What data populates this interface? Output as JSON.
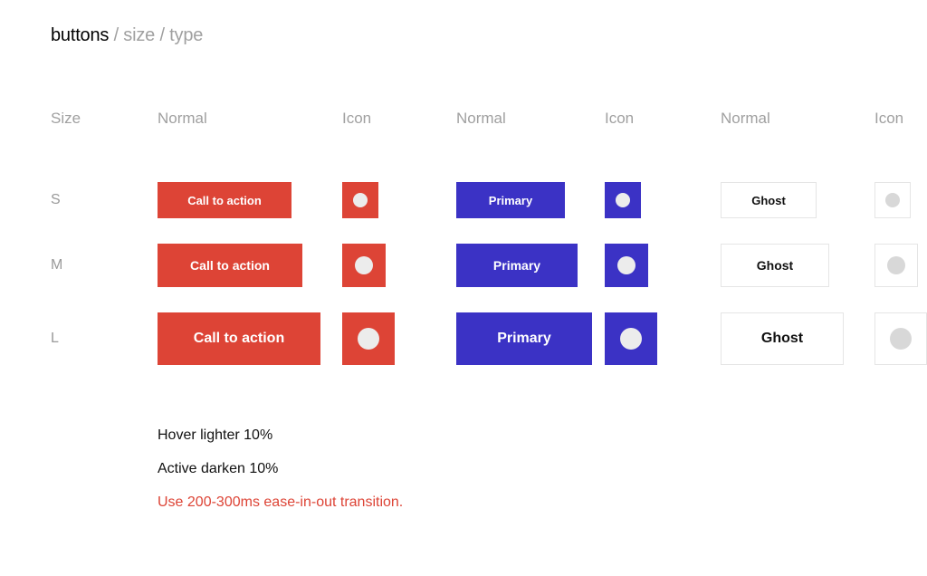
{
  "breadcrumb": {
    "seg1": "buttons",
    "seg2": "size",
    "seg3": "type"
  },
  "headers": {
    "size": "Size",
    "normal": "Normal",
    "icon": "Icon"
  },
  "rows": {
    "s": {
      "label": "S"
    },
    "m": {
      "label": "M"
    },
    "l": {
      "label": "L"
    }
  },
  "buttons": {
    "cta": {
      "label": "Call to action"
    },
    "primary": {
      "label": "Primary"
    },
    "ghost": {
      "label": "Ghost"
    }
  },
  "icons": {
    "placeholder": "circle-placeholder-icon"
  },
  "notes": {
    "hover": "Hover lighter 10%",
    "active": "Active darken 10%",
    "transition": "Use 200-300ms ease-in-out transition."
  },
  "colors": {
    "cta_bg": "#dd4436",
    "primary_bg": "#3b32c5",
    "ghost_border": "#e5e5e5",
    "muted_text": "#a0a0a0"
  }
}
